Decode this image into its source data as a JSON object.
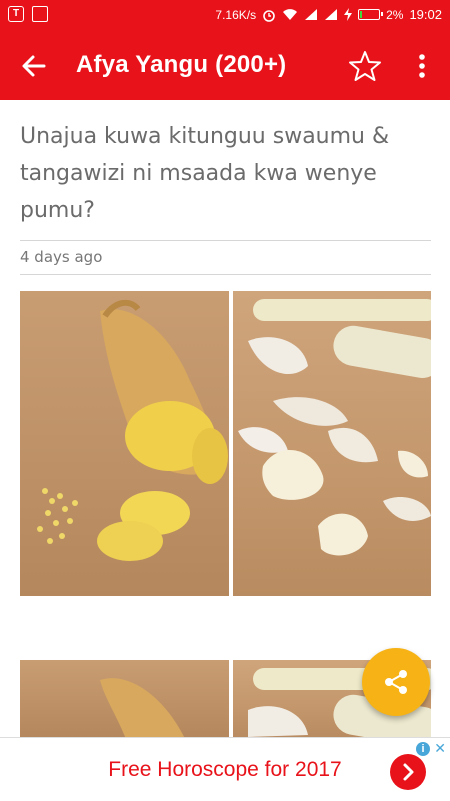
{
  "status_bar": {
    "speed": "7.16K/s",
    "battery_percent": "2%",
    "time": "19:02"
  },
  "app_bar": {
    "title": "Afya Yangu (200+)",
    "back_icon": "arrow-left-icon",
    "favorite_icon": "star-outline-icon",
    "menu_icon": "more-vert-icon"
  },
  "article": {
    "headline": "Unajua kuwa kitunguu swaumu & tangawizi ni msaada kwa wenye pumu?",
    "date": "4 days ago",
    "images": [
      "ginger-photo",
      "garlic-photo"
    ]
  },
  "fab": {
    "icon": "share-icon",
    "color": "#f7b316"
  },
  "ad": {
    "text": "Free Horoscope for 2017",
    "info_icon": "info-icon",
    "close_icon": "close-icon",
    "cta_icon": "chevron-right-icon"
  },
  "colors": {
    "primary": "#e8131a",
    "accent": "#f7b316"
  }
}
